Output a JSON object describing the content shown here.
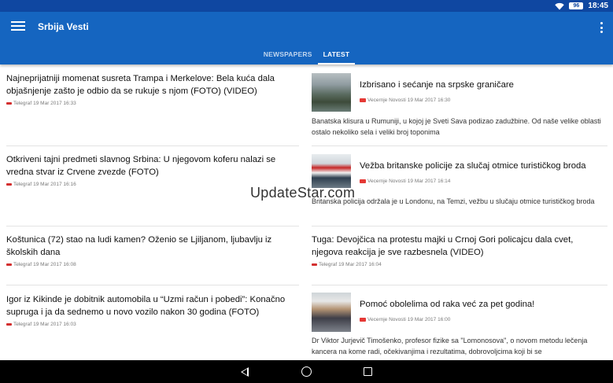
{
  "status": {
    "battery": "96",
    "time": "18:45"
  },
  "app": {
    "title": "Srbija Vesti"
  },
  "tabs": [
    {
      "label": "NEWSPAPERS"
    },
    {
      "label": "LATEST"
    }
  ],
  "left_articles": [
    {
      "title": "Najneprijatniji momenat susreta Trampa i Merkelove: Bela kuća dala objašnjenje zašto je odbio da se rukuje s njom (FOTO) (VIDEO)",
      "source": "Telegraf",
      "date": "19 Mar 2017 16:33"
    },
    {
      "title": "Otkriveni tajni predmeti slavnog Srbina: U njegovom koferu nalazi se vredna stvar iz Crvene zvezde (FOTO)",
      "source": "Telegraf",
      "date": "19 Mar 2017 16:16"
    },
    {
      "title": "Koštunica (72) stao na ludi kamen? Oženio se Ljiljanom, ljubavlju iz školskih dana",
      "source": "Telegraf",
      "date": "19 Mar 2017 16:08"
    },
    {
      "title": "Igor iz Kikinde je dobitnik automobila u “Uzmi račun i pobedi”: Konačno supruga i ja da sednemo u novo vozilo nakon 30 godina (FOTO)",
      "source": "Telegraf",
      "date": "19 Mar 2017 16:03"
    }
  ],
  "right_articles": [
    {
      "title": "Izbrisano i sećanje na srpske graničare",
      "source": "Vecernje Novosti",
      "date": "19 Mar 2017 16:30",
      "summary": "Banatska klisura u Rumuniji, u kojoj je Sveti Sava podizao zadužbine. Od naše velike oblasti ostalo nekoliko sela i veliki broj toponima"
    },
    {
      "title": "Vežba britanske policije za slučaj otmice turističkog broda",
      "source": "Vecernje Novosti",
      "date": "19 Mar 2017 16:14",
      "summary": "Britanska policija održala je u Londonu, na Temzi, vežbu u slučaju otmice turističkog broda"
    },
    {
      "title": "Tuga: Devojčica na protestu majki u Crnoj Gori policajcu dala cvet, njegova reakcija je sve razbesnela (VIDEO)",
      "source": "Telegraf",
      "date": "19 Mar 2017 16:04"
    },
    {
      "title": "Pomoć obolelima od raka već za pet godina!",
      "source": "Vecernje Novosti",
      "date": "19 Mar 2017 16:00",
      "summary": "Dr Viktor Jurjevič Timošenko, profesor fizike sa \"Lomonosova\", o novom metodu lečenja kancera na kome radi, očekivanjima i rezultatima, dobrovoljcima koji bi se"
    }
  ],
  "watermark": "UpdateStar.com"
}
